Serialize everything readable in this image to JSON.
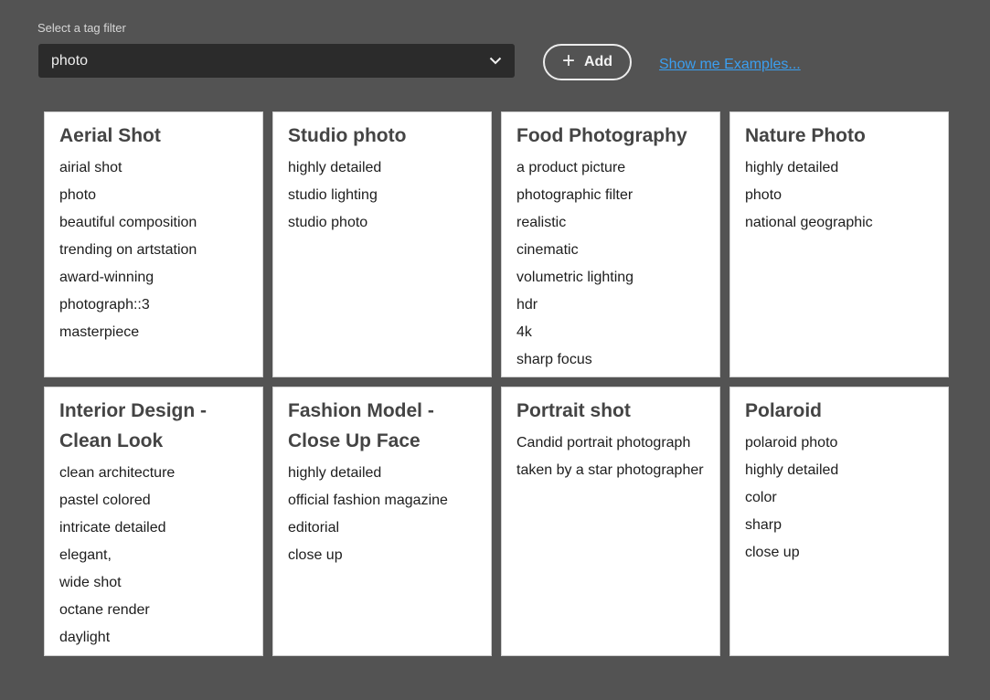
{
  "filter": {
    "label": "Select a tag filter",
    "selected": "photo",
    "chevron_icon": "chevron-down-icon"
  },
  "add_button": {
    "icon": "plus-icon",
    "icon_glyph": "+",
    "label": "Add"
  },
  "examples_link": {
    "label": "Show me Examples..."
  },
  "colors": {
    "background": "#535353",
    "select_background": "#2b2b2b",
    "link": "#3b9ff0",
    "card_background": "#ffffff"
  },
  "cards": [
    {
      "title": "Aerial Shot",
      "tags": [
        "airial shot",
        "photo",
        "beautiful composition",
        "trending on artstation",
        "award-winning",
        "photograph::3",
        "masterpiece"
      ]
    },
    {
      "title": "Studio photo",
      "tags": [
        "highly detailed",
        "studio lighting",
        "studio photo"
      ]
    },
    {
      "title": "Food Photography",
      "tags": [
        "a product picture",
        "photographic filter",
        "realistic",
        "cinematic",
        "volumetric lighting",
        "hdr",
        "4k",
        "sharp focus"
      ]
    },
    {
      "title": "Nature Photo",
      "tags": [
        "highly detailed",
        "photo",
        "national geographic"
      ]
    },
    {
      "title": "Interior Design - Clean Look",
      "tags": [
        "clean architecture",
        "pastel colored",
        "intricate detailed",
        "elegant,",
        "wide shot",
        "octane render",
        "daylight"
      ]
    },
    {
      "title": "Fashion Model - Close Up Face",
      "tags": [
        "highly detailed",
        "official fashion magazine",
        "editorial",
        "close up"
      ]
    },
    {
      "title": "Portrait shot",
      "tags": [
        "Candid portrait photograph",
        "taken by a star photographer"
      ]
    },
    {
      "title": "Polaroid",
      "tags": [
        "polaroid photo",
        "highly detailed",
        "color",
        "sharp",
        "close up"
      ]
    }
  ]
}
